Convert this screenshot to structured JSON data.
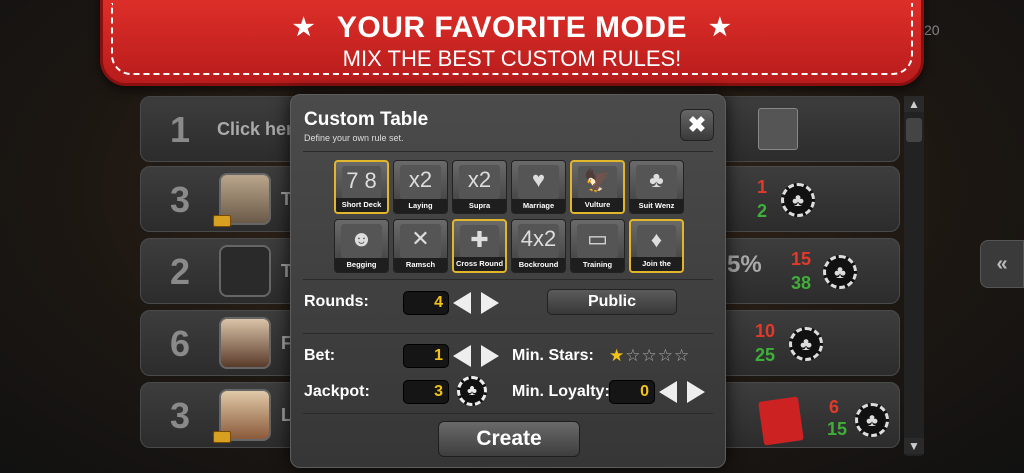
{
  "banner": {
    "title": "YOUR FAVORITE MODE",
    "subtitle": "MIX THE BEST CUSTOM RULES!",
    "star_glyph": "★"
  },
  "background": {
    "corner_text": "20",
    "rows": [
      {
        "rank": "1",
        "name": "Click her",
        "red": "",
        "green": ""
      },
      {
        "rank": "3",
        "name": "Ta",
        "red": "1",
        "green": "2"
      },
      {
        "rank": "2",
        "name": "T",
        "red": "15",
        "green": "38",
        "percent": "5%"
      },
      {
        "rank": "6",
        "name": "Fi",
        "red": "10",
        "green": "25"
      },
      {
        "rank": "3",
        "name": "Li",
        "red": "6",
        "green": "15"
      }
    ],
    "side_tab": "«",
    "scroll_up": "▲",
    "scroll_down": "▼"
  },
  "dialog": {
    "title": "Custom Table",
    "subtitle": "Define your own rule set.",
    "close_glyph": "✖",
    "rules": [
      {
        "label": "Short Deck",
        "glyph": "7 8",
        "selected": true
      },
      {
        "label": "Laying",
        "glyph": "x2",
        "selected": false
      },
      {
        "label": "Supra",
        "glyph": "x2",
        "selected": false
      },
      {
        "label": "Marriage",
        "glyph": "♥",
        "selected": false
      },
      {
        "label": "Vulture",
        "glyph": "🦅",
        "selected": true
      },
      {
        "label": "Suit Wenz",
        "glyph": "♣",
        "selected": false
      },
      {
        "label": "Begging",
        "glyph": "☻",
        "selected": false
      },
      {
        "label": "Ramsch",
        "glyph": "✕",
        "selected": false
      },
      {
        "label": "Cross Round",
        "glyph": "✚",
        "selected": true
      },
      {
        "label": "Bockround",
        "glyph": "4x2",
        "selected": false
      },
      {
        "label": "Training",
        "glyph": "▭",
        "selected": false
      },
      {
        "label": "Join the Community",
        "glyph": "♦",
        "selected": true
      }
    ],
    "rounds_label": "Rounds:",
    "rounds_value": "4",
    "public_label": "Public",
    "bet_label": "Bet:",
    "bet_value": "1",
    "min_stars_label": "Min. Stars:",
    "min_stars_value": 1,
    "min_stars_max": 5,
    "jackpot_label": "Jackpot:",
    "jackpot_value": "3",
    "jackpot_chip_glyph": "♣",
    "min_loyalty_label": "Min. Loyalty:",
    "min_loyalty_value": "0",
    "create_label": "Create"
  },
  "colors": {
    "banner_red": "#d42a24",
    "accent_gold": "#f2c21b",
    "stat_red": "#e23a2a",
    "stat_green": "#3fae3a"
  }
}
